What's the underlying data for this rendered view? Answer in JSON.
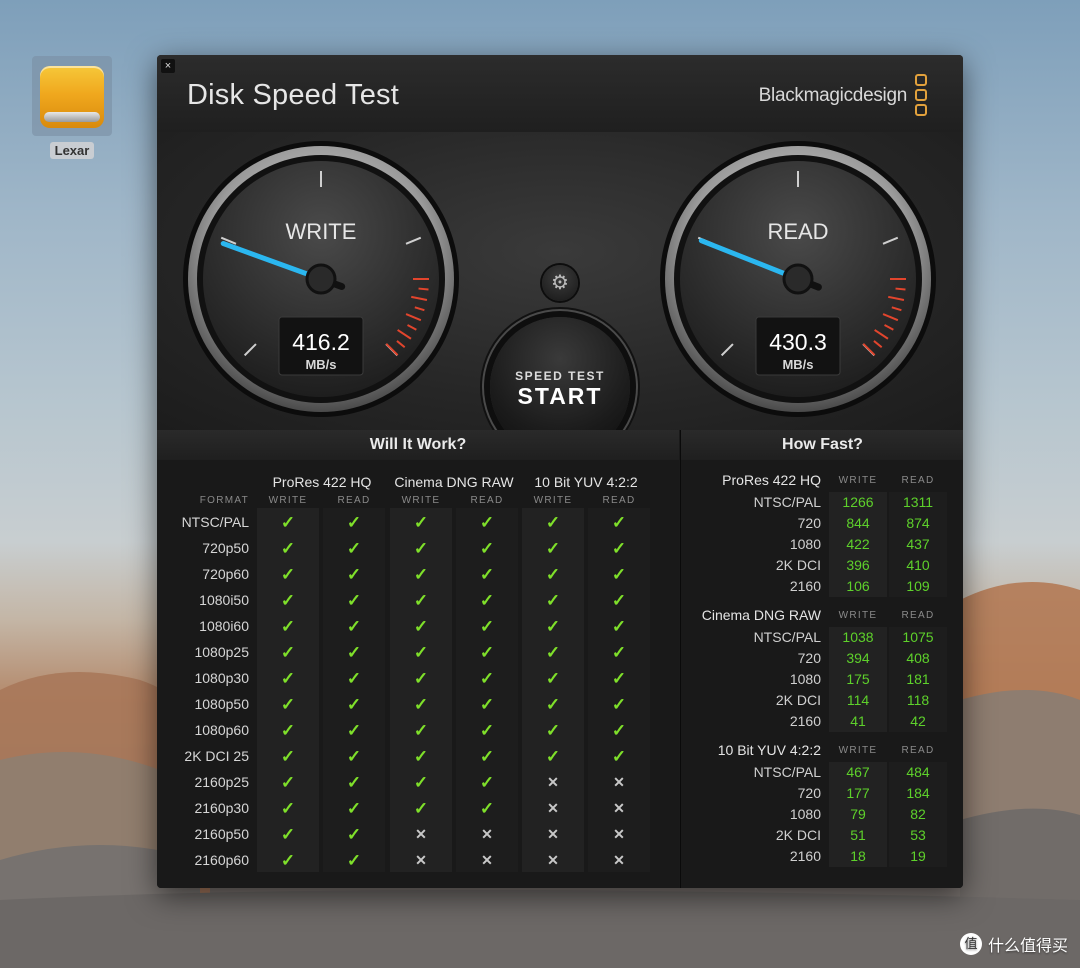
{
  "desktop": {
    "drive_label": "Lexar"
  },
  "window": {
    "title": "Disk Speed Test",
    "brand": "Blackmagicdesign",
    "close_glyph": "×",
    "brand_color": "#e2a13c"
  },
  "gauges": {
    "write": {
      "label": "WRITE",
      "value": "416.2",
      "unit": "MB/s",
      "speed_mbps": 416.2
    },
    "read": {
      "label": "READ",
      "value": "430.3",
      "unit": "MB/s",
      "speed_mbps": 430.3
    },
    "needle_color": "#2bb7f0"
  },
  "controls": {
    "settings_icon": "gear-icon",
    "start_small": "SPEED TEST",
    "start_big": "START"
  },
  "will_it_work": {
    "title": "Will It Work?",
    "format_header": "FORMAT",
    "write_header": "WRITE",
    "read_header": "READ",
    "codecs": [
      "ProRes 422 HQ",
      "Cinema DNG RAW",
      "10 Bit YUV 4:2:2"
    ],
    "ok_glyph": "✓",
    "no_glyph": "✕",
    "ok_color": "#7fe02a",
    "rows": [
      {
        "format": "NTSC/PAL",
        "results": [
          true,
          true,
          true,
          true,
          true,
          true
        ]
      },
      {
        "format": "720p50",
        "results": [
          true,
          true,
          true,
          true,
          true,
          true
        ]
      },
      {
        "format": "720p60",
        "results": [
          true,
          true,
          true,
          true,
          true,
          true
        ]
      },
      {
        "format": "1080i50",
        "results": [
          true,
          true,
          true,
          true,
          true,
          true
        ]
      },
      {
        "format": "1080i60",
        "results": [
          true,
          true,
          true,
          true,
          true,
          true
        ]
      },
      {
        "format": "1080p25",
        "results": [
          true,
          true,
          true,
          true,
          true,
          true
        ]
      },
      {
        "format": "1080p30",
        "results": [
          true,
          true,
          true,
          true,
          true,
          true
        ]
      },
      {
        "format": "1080p50",
        "results": [
          true,
          true,
          true,
          true,
          true,
          true
        ]
      },
      {
        "format": "1080p60",
        "results": [
          true,
          true,
          true,
          true,
          true,
          true
        ]
      },
      {
        "format": "2K DCI 25",
        "results": [
          true,
          true,
          true,
          true,
          true,
          true
        ]
      },
      {
        "format": "2160p25",
        "results": [
          true,
          true,
          true,
          true,
          false,
          false
        ]
      },
      {
        "format": "2160p30",
        "results": [
          true,
          true,
          true,
          true,
          false,
          false
        ]
      },
      {
        "format": "2160p50",
        "results": [
          true,
          true,
          false,
          false,
          false,
          false
        ]
      },
      {
        "format": "2160p60",
        "results": [
          true,
          true,
          false,
          false,
          false,
          false
        ]
      }
    ]
  },
  "how_fast": {
    "title": "How Fast?",
    "write_header": "WRITE",
    "read_header": "READ",
    "value_color": "#5ed12b",
    "groups": [
      {
        "name": "ProRes 422 HQ",
        "rows": [
          {
            "format": "NTSC/PAL",
            "write": "1266",
            "read": "1311"
          },
          {
            "format": "720",
            "write": "844",
            "read": "874"
          },
          {
            "format": "1080",
            "write": "422",
            "read": "437"
          },
          {
            "format": "2K DCI",
            "write": "396",
            "read": "410"
          },
          {
            "format": "2160",
            "write": "106",
            "read": "109"
          }
        ]
      },
      {
        "name": "Cinema DNG RAW",
        "rows": [
          {
            "format": "NTSC/PAL",
            "write": "1038",
            "read": "1075"
          },
          {
            "format": "720",
            "write": "394",
            "read": "408"
          },
          {
            "format": "1080",
            "write": "175",
            "read": "181"
          },
          {
            "format": "2K DCI",
            "write": "114",
            "read": "118"
          },
          {
            "format": "2160",
            "write": "41",
            "read": "42"
          }
        ]
      },
      {
        "name": "10 Bit YUV 4:2:2",
        "rows": [
          {
            "format": "NTSC/PAL",
            "write": "467",
            "read": "484"
          },
          {
            "format": "720",
            "write": "177",
            "read": "184"
          },
          {
            "format": "1080",
            "write": "79",
            "read": "82"
          },
          {
            "format": "2K DCI",
            "write": "51",
            "read": "53"
          },
          {
            "format": "2160",
            "write": "18",
            "read": "19"
          }
        ]
      }
    ]
  },
  "watermark": {
    "text": "什么值得买",
    "badge": "值"
  }
}
